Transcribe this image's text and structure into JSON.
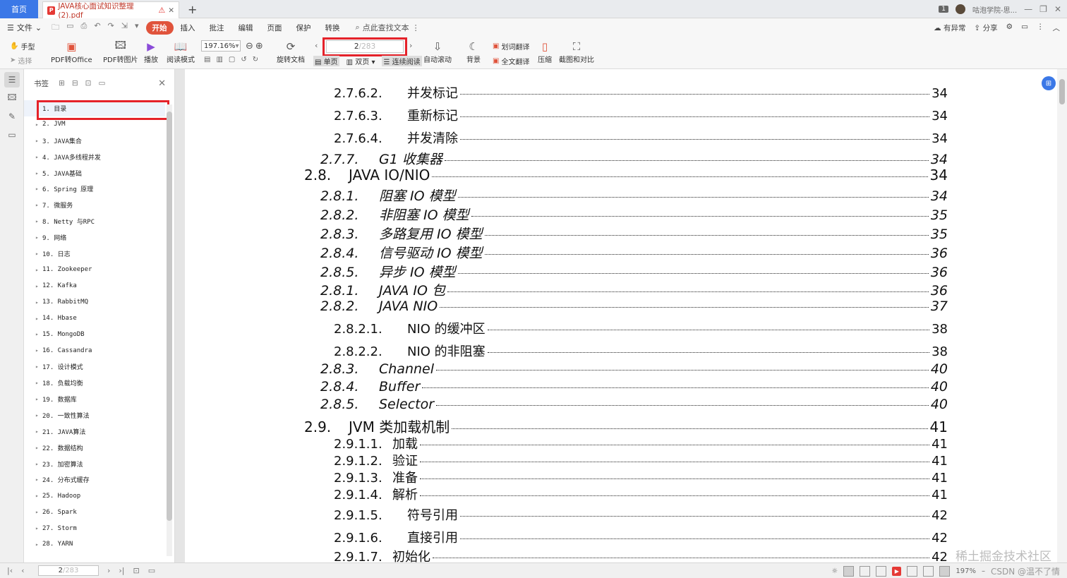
{
  "tabs": {
    "home": "首页",
    "doc_title": "JAVA核心面试知识整理 (2).pdf",
    "badge_count": "1",
    "user": "咕泡学院-思..."
  },
  "menu": {
    "file": "文件",
    "items": [
      "开始",
      "插入",
      "批注",
      "编辑",
      "页面",
      "保护",
      "转换"
    ],
    "search": "点此查找文本",
    "right": [
      "有异常",
      "分享"
    ]
  },
  "toolbar": {
    "hand": "手型",
    "select": "选择",
    "pdf_to_office": "PDF转Office",
    "pdf_to_image": "PDF转图片",
    "play": "播放",
    "read_mode": "阅读模式",
    "zoom": "197.16%",
    "rotate": "旋转文档",
    "page_current": "2",
    "page_total": "/283",
    "single": "单页",
    "double": "双页",
    "continuous": "连续阅读",
    "auto_scroll": "自动滚动",
    "background": "背景",
    "word_translate": "划词翻译",
    "full_translate": "全文翻译",
    "compress": "压缩",
    "screenshot_compare": "截图和对比"
  },
  "bookmark": {
    "title": "书签",
    "items": [
      "1. 目录",
      "2. JVM",
      "3. JAVA集合",
      "4. JAVA多线程并发",
      "5. JAVA基础",
      "6. Spring 原理",
      "7.   微服务",
      "8. Netty 与RPC",
      "9. 网络",
      "10. 日志",
      "11. Zookeeper",
      "12. Kafka",
      "13. RabbitMQ",
      "14. Hbase",
      "15. MongoDB",
      "16. Cassandra",
      "17. 设计模式",
      "18. 负载均衡",
      "19. 数据库",
      "20. 一致性算法",
      "21. JAVA算法",
      "22. 数据结构",
      "23. 加密算法",
      "24. 分布式缓存",
      "25. Hadoop",
      "26. Spark",
      "27. Storm",
      "28. YARN"
    ]
  },
  "toc": [
    {
      "num": "2.7.6.2.",
      "title": "并发标记",
      "page": "34",
      "level": "l4"
    },
    {
      "num": "2.7.6.3.",
      "title": "重新标记",
      "page": "34",
      "level": "l4"
    },
    {
      "num": "2.7.6.4.",
      "title": "并发清除",
      "page": "34",
      "level": "l4"
    },
    {
      "num": "2.7.7.",
      "title": "G1 收集器",
      "page": "34",
      "level": "l3"
    },
    {
      "num": "2.8.",
      "title": "JAVA IO/NIO",
      "page": "34",
      "level": "l2"
    },
    {
      "num": "2.8.1.",
      "title": "阻塞 IO 模型",
      "page": "34",
      "level": "l3"
    },
    {
      "num": "2.8.2.",
      "title": "非阻塞 IO 模型",
      "page": "35",
      "level": "l3"
    },
    {
      "num": "2.8.3.",
      "title": "多路复用 IO 模型",
      "page": "35",
      "level": "l3"
    },
    {
      "num": "2.8.4.",
      "title": "信号驱动 IO 模型",
      "page": "36",
      "level": "l3"
    },
    {
      "num": "2.8.5.",
      "title": "异步 IO 模型",
      "page": "36",
      "level": "l3"
    },
    {
      "num": "2.8.1.",
      "title": "JAVA IO 包",
      "page": "36",
      "level": "l3"
    },
    {
      "num": "2.8.2.",
      "title": "JAVA NIO",
      "page": "37",
      "level": "l3"
    },
    {
      "num": "2.8.2.1.",
      "title": "NIO 的缓冲区",
      "page": "38",
      "level": "l4"
    },
    {
      "num": "2.8.2.2.",
      "title": "NIO 的非阻塞",
      "page": "38",
      "level": "l4"
    },
    {
      "num": "2.8.3.",
      "title": "Channel",
      "page": "40",
      "level": "l3"
    },
    {
      "num": "2.8.4.",
      "title": "Buffer",
      "page": "40",
      "level": "l3"
    },
    {
      "num": "2.8.5.",
      "title": "Selector",
      "page": "40",
      "level": "l3"
    },
    {
      "num": "2.9.",
      "title": "JVM 类加载机制",
      "page": "41",
      "level": "l2"
    },
    {
      "num": "2.9.1.1.",
      "title": "加载",
      "page": "41",
      "level": "l4s"
    },
    {
      "num": "2.9.1.2.",
      "title": "验证",
      "page": "41",
      "level": "l4s"
    },
    {
      "num": "2.9.1.3.",
      "title": "准备",
      "page": "41",
      "level": "l4s"
    },
    {
      "num": "2.9.1.4.",
      "title": "解析",
      "page": "41",
      "level": "l4s"
    },
    {
      "num": "2.9.1.5.",
      "title": "符号引用",
      "page": "42",
      "level": "l4"
    },
    {
      "num": "2.9.1.6.",
      "title": "直接引用",
      "page": "42",
      "level": "l4"
    },
    {
      "num": "2.9.1.7.",
      "title": "初始化",
      "page": "42",
      "level": "l4s"
    }
  ],
  "status": {
    "page_current": "2",
    "page_total": "/283",
    "zoom": "197%"
  },
  "watermark": {
    "main": "稀土掘金技术社区",
    "sub": "CSDN @温不了情"
  },
  "colors": {
    "accent": "#3b78e7",
    "highlight": "#e5222a",
    "active_menu": "#e0533b"
  }
}
